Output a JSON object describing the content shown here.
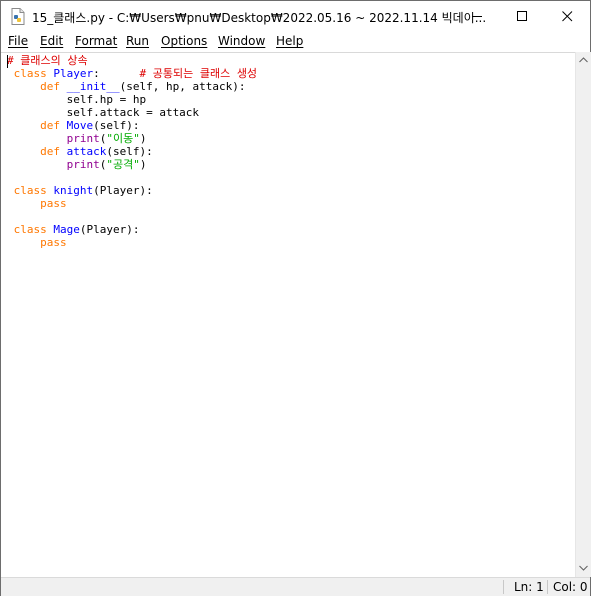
{
  "window": {
    "title": "15_클래스.py - C:₩Users₩pnu₩Desktop₩2022.05.16 ~ 2022.11.14 빅데이..."
  },
  "menu": [
    "File",
    "Edit",
    "Format",
    "Run",
    "Options",
    "Window",
    "Help"
  ],
  "code_lines": [
    [
      {
        "t": "# 클래스의 상속",
        "c": "cm"
      }
    ],
    [
      {
        "t": " "
      },
      {
        "t": "class",
        "c": "kw"
      },
      {
        "t": " "
      },
      {
        "t": "Player",
        "c": "df"
      },
      {
        "t": ":      "
      },
      {
        "t": "# 공통되는 클래스 생성",
        "c": "cm"
      }
    ],
    [
      {
        "t": "     "
      },
      {
        "t": "def",
        "c": "kw"
      },
      {
        "t": " "
      },
      {
        "t": "__init__",
        "c": "df"
      },
      {
        "t": "(self, hp, attack):"
      }
    ],
    [
      {
        "t": "         self.hp = hp"
      }
    ],
    [
      {
        "t": "         self.attack = attack"
      }
    ],
    [
      {
        "t": "     "
      },
      {
        "t": "def",
        "c": "kw"
      },
      {
        "t": " "
      },
      {
        "t": "Move",
        "c": "df"
      },
      {
        "t": "(self):"
      }
    ],
    [
      {
        "t": "         "
      },
      {
        "t": "print",
        "c": "bi"
      },
      {
        "t": "("
      },
      {
        "t": "\"이동\"",
        "c": "st"
      },
      {
        "t": ")"
      }
    ],
    [
      {
        "t": "     "
      },
      {
        "t": "def",
        "c": "kw"
      },
      {
        "t": " "
      },
      {
        "t": "attack",
        "c": "df"
      },
      {
        "t": "(self):"
      }
    ],
    [
      {
        "t": "         "
      },
      {
        "t": "print",
        "c": "bi"
      },
      {
        "t": "("
      },
      {
        "t": "\"공격\"",
        "c": "st"
      },
      {
        "t": ")"
      }
    ],
    [
      {
        "t": ""
      }
    ],
    [
      {
        "t": " "
      },
      {
        "t": "class",
        "c": "kw"
      },
      {
        "t": " "
      },
      {
        "t": "knight",
        "c": "df"
      },
      {
        "t": "(Player):"
      }
    ],
    [
      {
        "t": "     "
      },
      {
        "t": "pass",
        "c": "kw"
      }
    ],
    [
      {
        "t": ""
      }
    ],
    [
      {
        "t": " "
      },
      {
        "t": "class",
        "c": "kw"
      },
      {
        "t": " "
      },
      {
        "t": "Mage",
        "c": "df"
      },
      {
        "t": "(Player):"
      }
    ],
    [
      {
        "t": "     "
      },
      {
        "t": "pass",
        "c": "kw"
      }
    ]
  ],
  "status": {
    "line": "Ln: 1",
    "col": "Col: 0"
  },
  "colors": {
    "keyword": "#ff7700",
    "comment": "#dd0000",
    "definition": "#0000ff",
    "builtin": "#900090",
    "string": "#00aa00"
  }
}
